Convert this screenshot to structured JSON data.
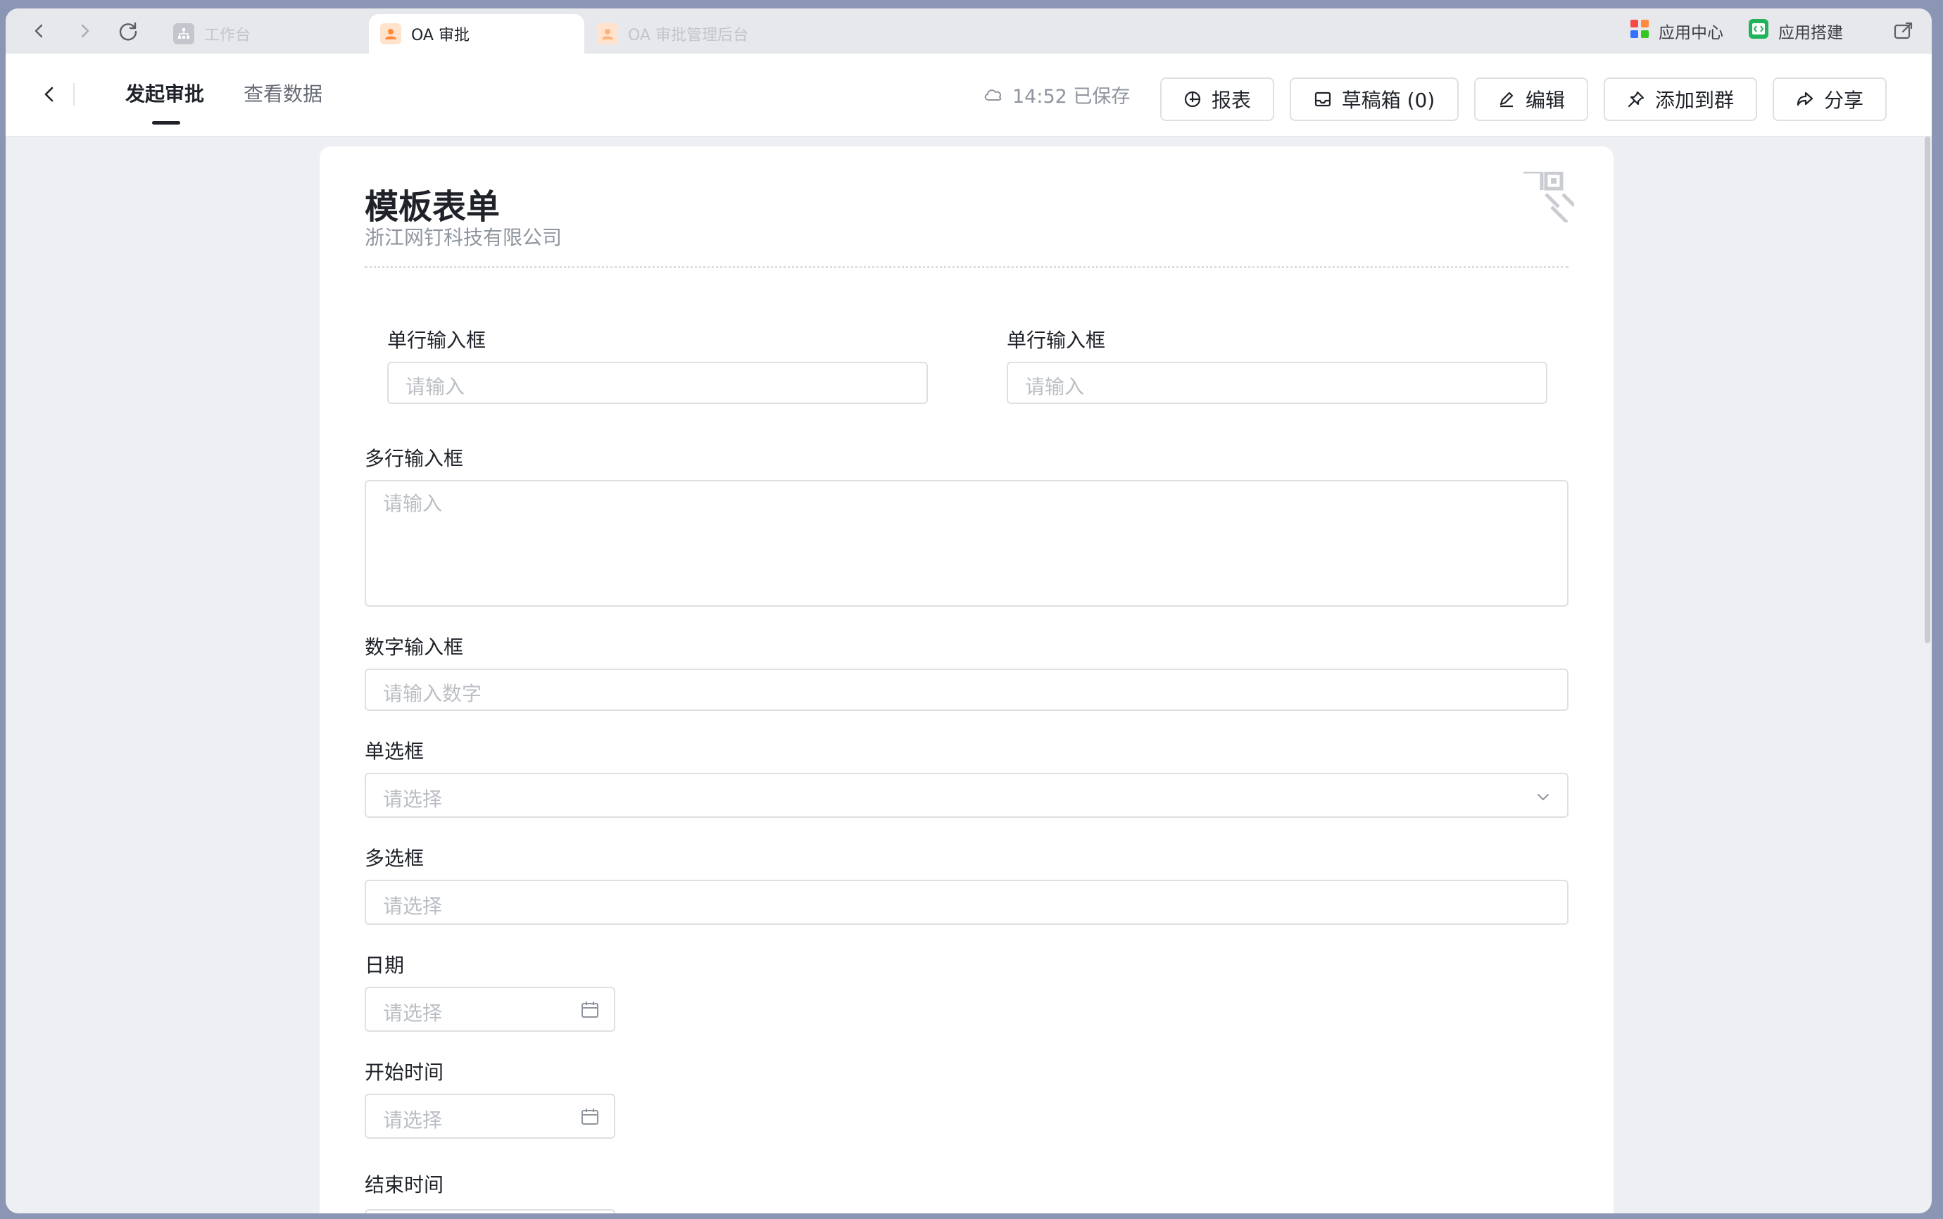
{
  "browser": {
    "tabs": [
      {
        "label": "工作台",
        "icon": "workbench-icon",
        "active": false
      },
      {
        "label": "OA 审批",
        "icon": "oa-app-icon",
        "active": true
      },
      {
        "label": "OA 审批管理后台",
        "icon": "oa-app-icon",
        "active": false
      }
    ],
    "right": {
      "app_center": "应用中心",
      "app_builder": "应用搭建"
    }
  },
  "header": {
    "tabs": [
      {
        "label": "发起审批",
        "active": true
      },
      {
        "label": "查看数据",
        "active": false
      }
    ],
    "saved_status": "14:52 已保存",
    "buttons": {
      "report": "报表",
      "drafts": "草稿箱 (0)",
      "edit": "编辑",
      "add_to_group": "添加到群",
      "share": "分享"
    }
  },
  "form": {
    "title": "模板表单",
    "company": "浙江网钉科技有限公司",
    "fields": {
      "single_line_1": {
        "label": "单行输入框",
        "placeholder": "请输入"
      },
      "single_line_2": {
        "label": "单行输入框",
        "placeholder": "请输入"
      },
      "multi_line": {
        "label": "多行输入框",
        "placeholder": "请输入"
      },
      "number": {
        "label": "数字输入框",
        "placeholder": "请输入数字"
      },
      "radio": {
        "label": "单选框",
        "placeholder": "请选择"
      },
      "checkbox": {
        "label": "多选框",
        "placeholder": "请选择"
      },
      "date": {
        "label": "日期",
        "placeholder": "请选择"
      },
      "start_time": {
        "label": "开始时间",
        "placeholder": "请选择"
      },
      "end_time": {
        "label": "结束时间"
      }
    }
  },
  "colors": {
    "window_bg": "#eeeff2",
    "card_bg": "#ffffff",
    "text_primary": "#1f2329",
    "text_placeholder": "#bbbfc4",
    "border": "#dee0e3",
    "oa_icon": "#ff8a3d"
  }
}
